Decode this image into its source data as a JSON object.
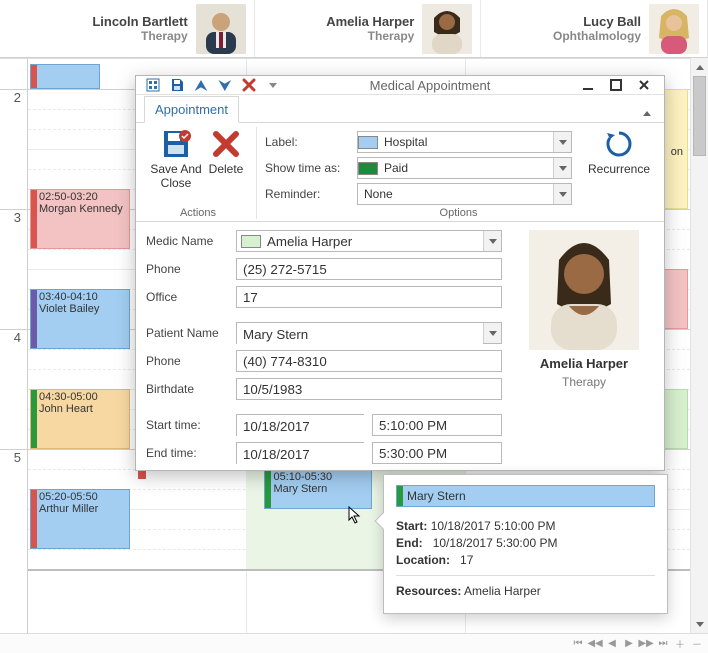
{
  "columns": [
    {
      "name": "Lincoln Bartlett",
      "dept": "Therapy"
    },
    {
      "name": "Amelia Harper",
      "dept": "Therapy"
    },
    {
      "name": "Lucy Ball",
      "dept": "Ophthalmology"
    }
  ],
  "time_labels": {
    "h2": "2",
    "h3": "3",
    "h4": "4",
    "h5": "5"
  },
  "appointments": {
    "a1": {
      "time": "02:50-03:20",
      "name": "Morgan Kennedy"
    },
    "a2": {
      "time": "03:40-04:10",
      "name": "Violet Bailey"
    },
    "a3": {
      "time": "04:30-05:00",
      "name": "John Heart"
    },
    "a4": {
      "time": "05:20-05:50",
      "name": "Arthur Miller"
    },
    "a5": {
      "time": "05:10-05:30",
      "name": "Mary Stern"
    },
    "a6_suffix": "on"
  },
  "dialog": {
    "title": "Medical Appointment",
    "tab": "Appointment",
    "actions_caption": "Actions",
    "options_caption": "Options",
    "save_close": "Save And Close",
    "delete": "Delete",
    "recurrence": "Recurrence",
    "labels": {
      "label": "Label:",
      "show_time_as": "Show time as:",
      "reminder": "Reminder:",
      "medic_name": "Medic Name",
      "phone": "Phone",
      "office": "Office",
      "patient_name": "Patient Name",
      "birthdate": "Birthdate",
      "start_time": "Start time:",
      "end_time": "End time:"
    },
    "values": {
      "label": "Hospital",
      "show_time_as": "Paid",
      "reminder": "None",
      "medic_name": "Amelia Harper",
      "medic_phone": "(25) 272-5715",
      "office": "17",
      "patient_name": "Mary Stern",
      "patient_phone": "(40) 774-8310",
      "birthdate": "10/5/1983",
      "start_date": "10/18/2017",
      "start_time": "5:10:00 PM",
      "end_date": "10/18/2017",
      "end_time": "5:30:00 PM",
      "side_name": "Amelia Harper",
      "side_dept": "Therapy"
    },
    "colors": {
      "label_swatch": "#a3cef1",
      "show_time_swatch": "#1f8a3b",
      "medic_swatch": "#d7f0cf"
    }
  },
  "tooltip": {
    "subject": "Mary Stern",
    "start_label": "Start:",
    "end_label": "End:",
    "location_label": "Location:",
    "resources_label": "Resources:",
    "start": "10/18/2017 5:10:00 PM",
    "end": "10/18/2017 5:30:00 PM",
    "location": "17",
    "resources": "Amelia Harper"
  }
}
